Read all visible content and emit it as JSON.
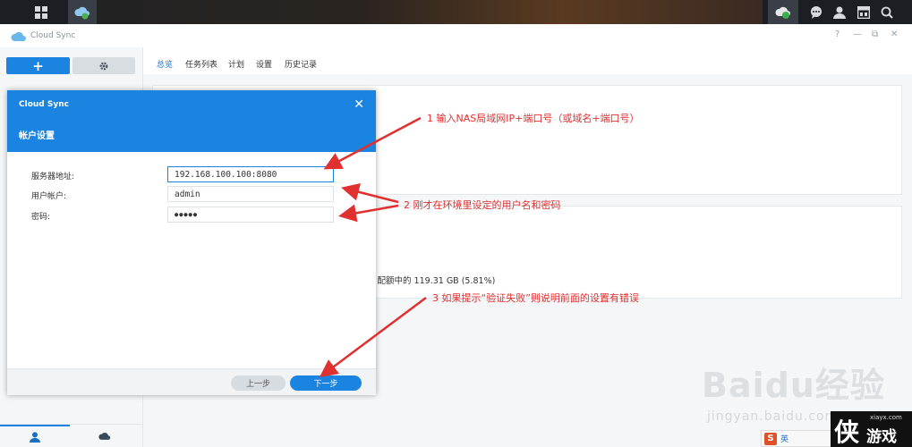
{
  "app": {
    "title": "Cloud Sync"
  },
  "taskbar": {
    "icons": [
      "grid-icon",
      "cloud-sync-app-icon",
      "cloud-sync-status-icon",
      "chat-icon",
      "user-icon",
      "widget-icon",
      "search-icon"
    ]
  },
  "main": {
    "tabs": [
      {
        "label": "总览",
        "active": true
      },
      {
        "label": "任务列表",
        "active": false
      },
      {
        "label": "计划",
        "active": false
      },
      {
        "label": "设置",
        "active": false
      },
      {
        "label": "历史记录",
        "active": false
      }
    ],
    "usage_text": "B 配额中的 119.31 GB (5.81%)"
  },
  "dialog": {
    "title": "Cloud Sync",
    "subtitle": "帐户设置",
    "fields": {
      "server": {
        "label": "服务器地址:",
        "value": "192.168.100.100:8080"
      },
      "user": {
        "label": "用户帐户:",
        "value": "admin"
      },
      "password": {
        "label": "密码:",
        "value": "●●●●●"
      }
    },
    "prev_label": "上一步",
    "next_label": "下一步"
  },
  "annotations": {
    "a1": "1 输入NAS局域网IP+端口号（或域名+端口号）",
    "a2": "2 刚才在环境里设定的用户名和密码",
    "a3": "3 如果提示“验证失败”则说明前面的设置有错误"
  },
  "watermark": {
    "baidu": "Baidu经验",
    "url": "jingyan.baidu.com",
    "site_url": "xiayx.com",
    "site_name": "游戏",
    "ime_label": "英"
  },
  "colors": {
    "accent": "#1a84e0",
    "annotation": "#e03030",
    "taskbar": "#1b1e23"
  }
}
